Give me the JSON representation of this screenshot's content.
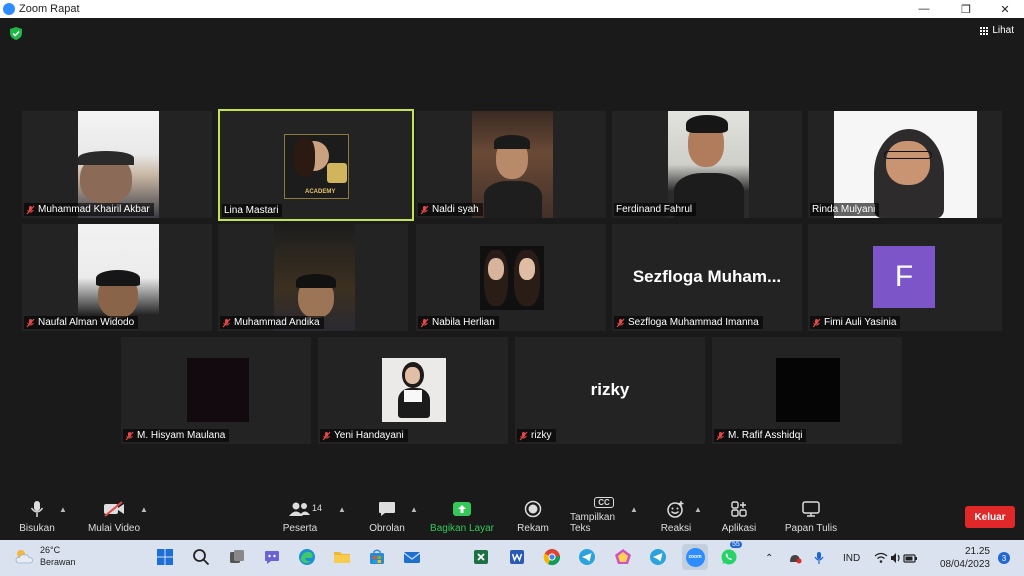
{
  "window": {
    "title": "Zoom Rapat",
    "minimize": "—",
    "maximize": "❐",
    "close": "✕"
  },
  "view": {
    "label": "Lihat"
  },
  "participants": [
    {
      "name": "Muhammad Khairil Akbar",
      "muted": true
    },
    {
      "name": "Lina Mastari",
      "muted": false,
      "active_speaker": true,
      "logo_text": "ACADEMY"
    },
    {
      "name": "Naldi syah",
      "muted": true
    },
    {
      "name": "Ferdinand Fahrul",
      "muted": false
    },
    {
      "name": "Rinda Mulyani",
      "muted": false
    },
    {
      "name": "Naufal Alman Widodo",
      "muted": true
    },
    {
      "name": "Muhammad Andika",
      "muted": true
    },
    {
      "name": "Nabila Herlian",
      "muted": true
    },
    {
      "name": "Sezfloga Muhammad Imanna",
      "display": "Sezfloga  Muham...",
      "muted": true
    },
    {
      "name": "Fimi Auli Yasinia",
      "initial": "F",
      "muted": true
    },
    {
      "name": "M. Hisyam Maulana",
      "muted": true
    },
    {
      "name": "Yeni Handayani",
      "muted": true
    },
    {
      "name": "rizky",
      "display": "rizky",
      "muted": true
    },
    {
      "name": "M. Rafif Asshidqi",
      "muted": true
    }
  ],
  "toolbar": {
    "mute": "Bisukan",
    "video": "Mulai Video",
    "participants": "Peserta",
    "participants_count": "14",
    "chat": "Obrolan",
    "share": "Bagikan Layar",
    "record": "Rekam",
    "captions": "Tampilkan Teks",
    "captions_icon": "CC",
    "reactions": "Reaksi",
    "apps": "Aplikasi",
    "whiteboard": "Papan Tulis",
    "leave": "Keluar"
  },
  "taskbar": {
    "weather_temp": "26°C",
    "weather_desc": "Berawan",
    "language": "IND",
    "time": "21.25",
    "date": "08/04/2023",
    "notifications": "3",
    "whatsapp_badge": "55",
    "zoom_label": "zoom"
  },
  "colors": {
    "active_border": "#c2e34b",
    "share_green": "#35c759",
    "leave_red": "#e02828",
    "avatar_purple": "#7c55c8",
    "zoom_blue": "#2d8cff"
  }
}
